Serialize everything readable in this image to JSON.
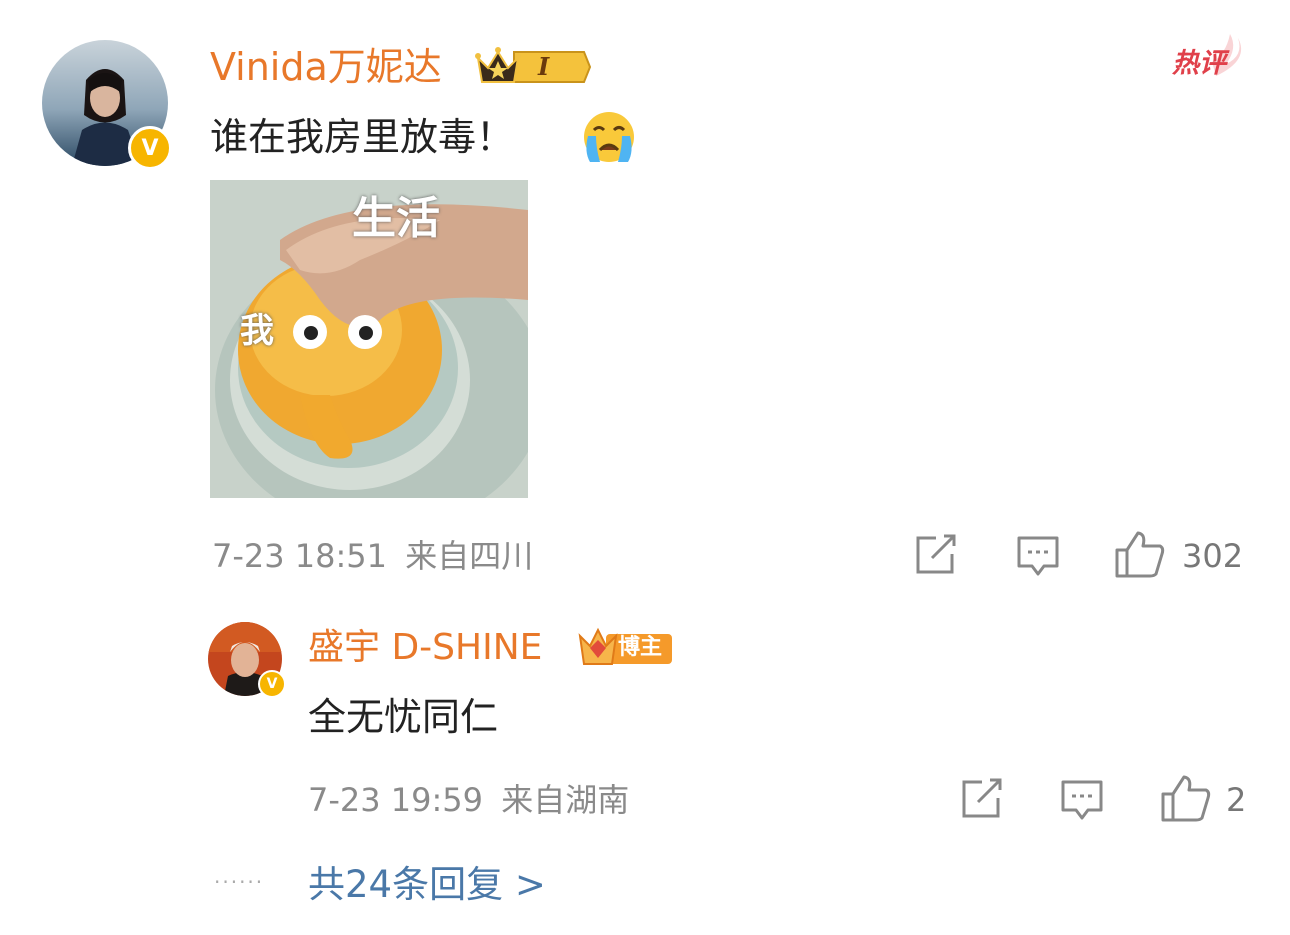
{
  "hot_label": "热评",
  "comment": {
    "username": "Vinida万妮达",
    "level_badge": "I",
    "text": "谁在我房里放毒！",
    "emoji": "crying-face-emoji",
    "image": {
      "caption_top": "生活",
      "caption_left": "我"
    },
    "timestamp": "7-23 18:51",
    "location": "来自四川",
    "like_count": "302"
  },
  "reply": {
    "username": "盛宇 D-SHINE",
    "blogger_badge": "博主",
    "text": "全无忧同仁",
    "timestamp": "7-23 19:59",
    "location": "来自湖南",
    "like_count": "2"
  },
  "more_replies": {
    "dots": "······",
    "label": "共24条回复 >"
  },
  "colors": {
    "username": "#e8782a",
    "link": "#4a78a8",
    "meta": "#8a8a8a",
    "hot": "#e0404a",
    "verified": "#f7b500"
  }
}
